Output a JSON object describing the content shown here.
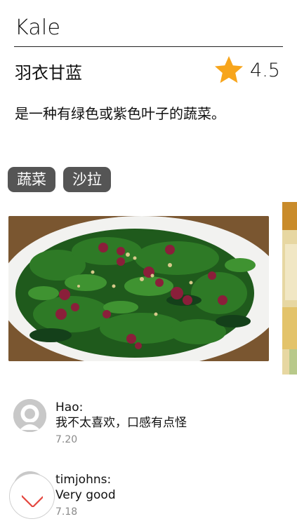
{
  "page": {
    "title": "Kale",
    "subtitle": "羽衣甘蓝",
    "rating": "4.5",
    "description": "是一种有绿色或紫色叶子的蔬菜。",
    "tags": [
      "蔬菜",
      "沙拉"
    ],
    "accent_star_color": "#f7a51c",
    "tag_background": "#555555"
  },
  "comments": [
    {
      "author": "Hao:",
      "text": "我不太喜欢，口感有点怪",
      "date": "7.20",
      "avatar": "person-icon"
    },
    {
      "author": "timjohns:",
      "text": "Very good",
      "date": "7.18",
      "avatar": "person-icon"
    }
  ],
  "fab": {
    "icon": "arrow-down-icon",
    "color": "#e4473f"
  },
  "gallery": {
    "images": [
      "kale-salad-photo",
      "next-photo-peek"
    ]
  }
}
